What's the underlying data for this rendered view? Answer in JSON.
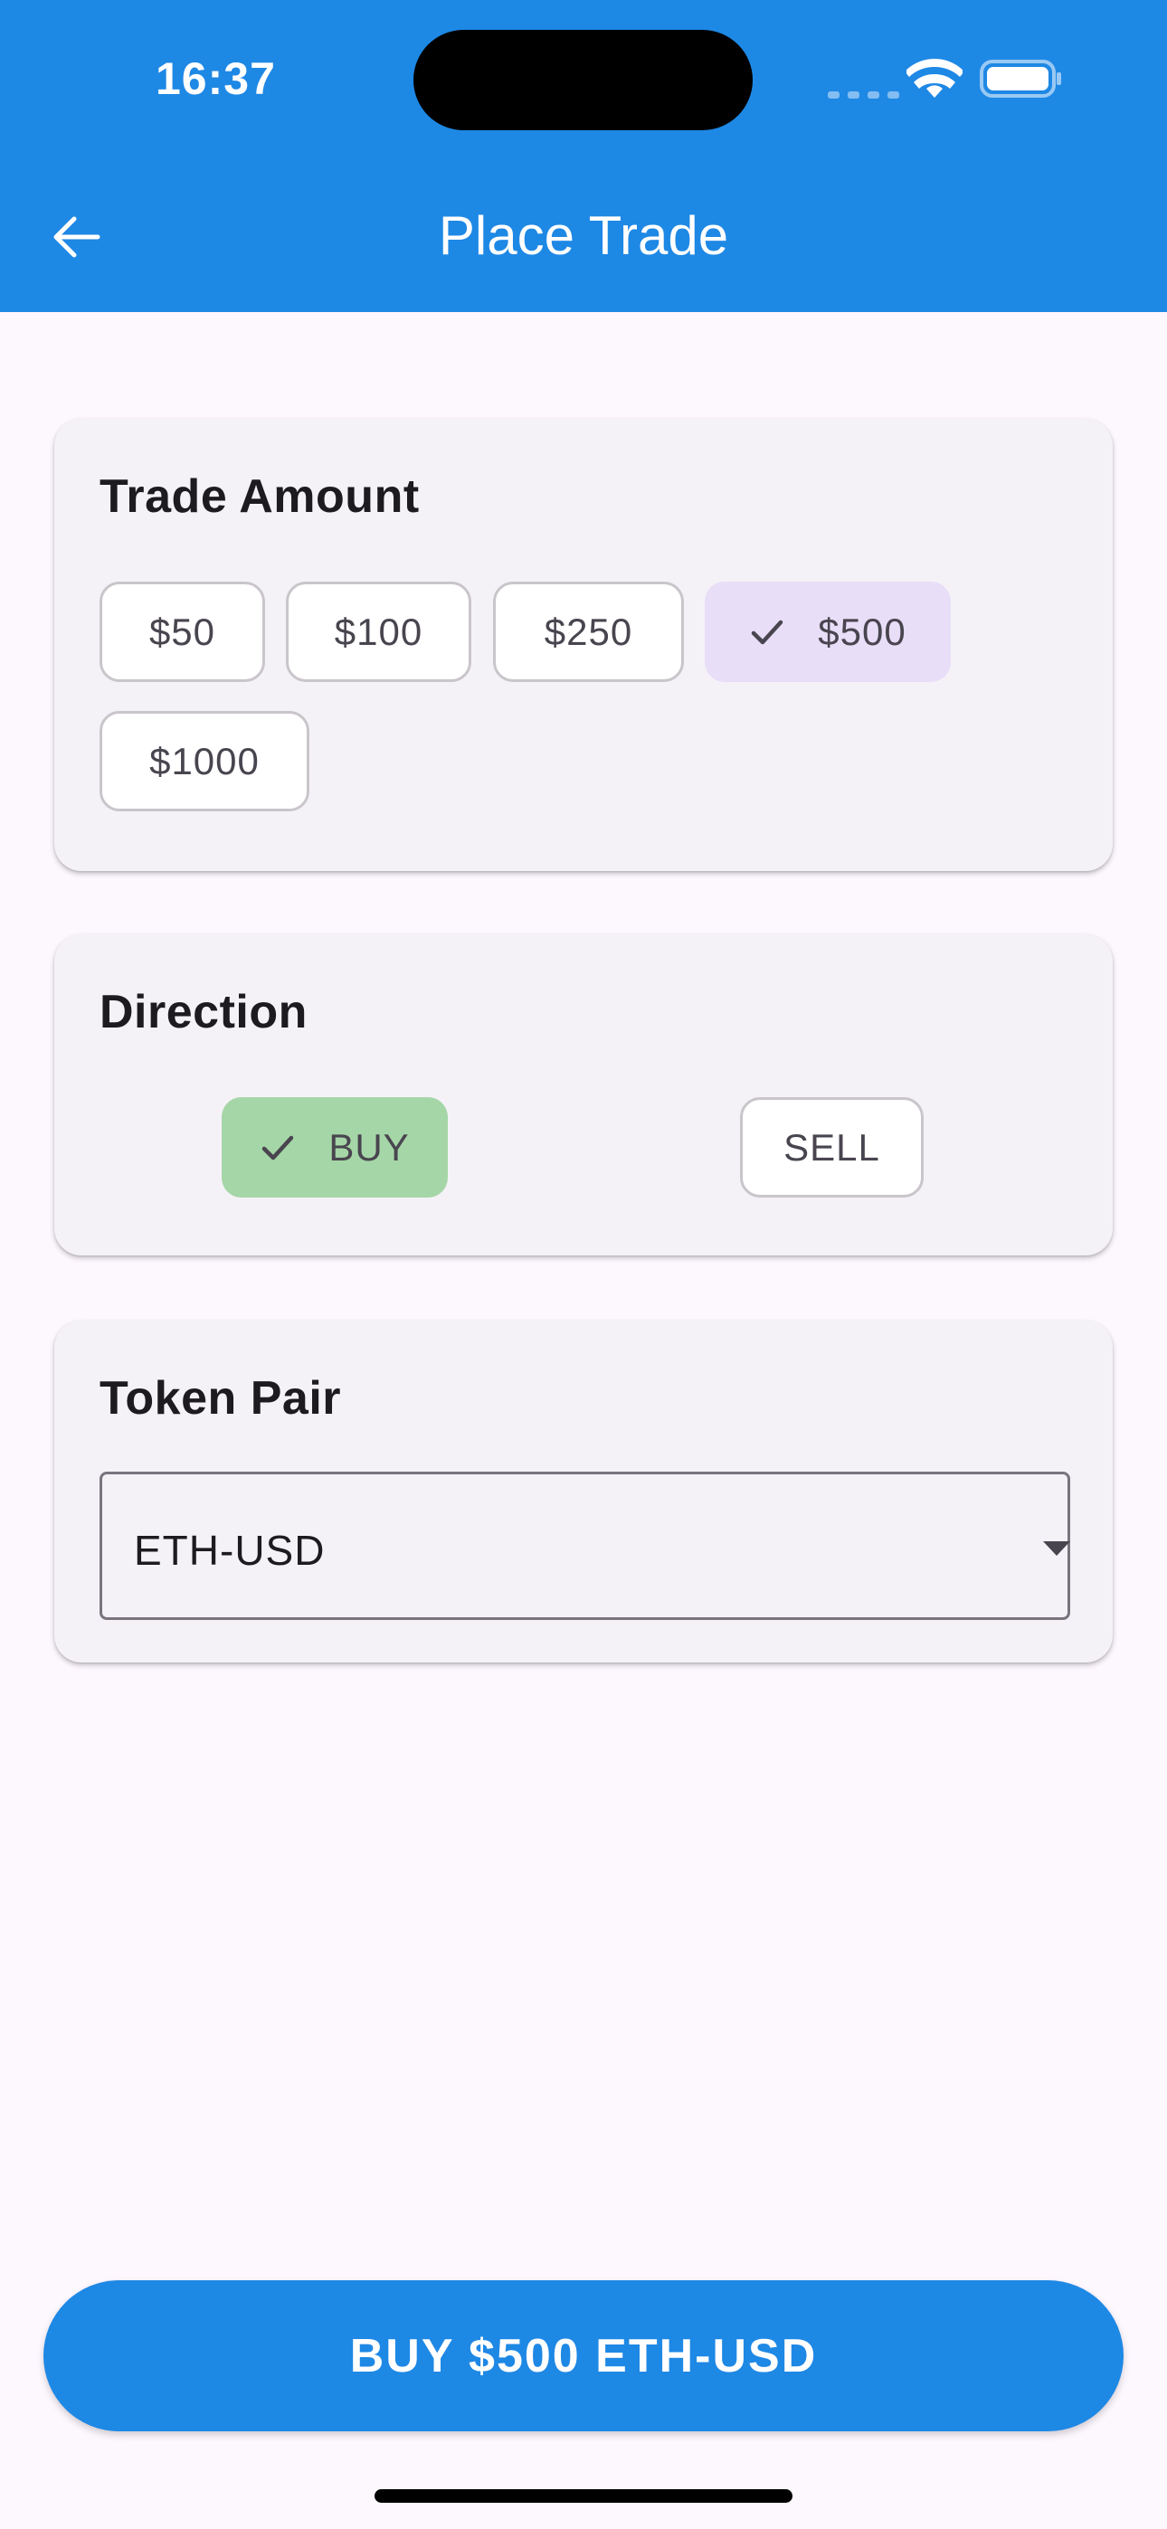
{
  "status_bar": {
    "time": "16:37"
  },
  "header": {
    "title": "Place Trade"
  },
  "trade_amount": {
    "title": "Trade Amount",
    "options": [
      "$50",
      "$100",
      "$250",
      "$500",
      "$1000"
    ],
    "selected": "$500"
  },
  "direction": {
    "title": "Direction",
    "options": [
      "BUY",
      "SELL"
    ],
    "selected": "BUY"
  },
  "token_pair": {
    "title": "Token Pair",
    "value": "ETH-USD"
  },
  "submit": {
    "label": "BUY $500 ETH-USD"
  },
  "colors": {
    "primary": "#1e88e5",
    "amount_selected": "#e8def8",
    "buy_selected": "#a5d6a7",
    "background": "#fdf7fe",
    "card": "#f5f2f7"
  }
}
